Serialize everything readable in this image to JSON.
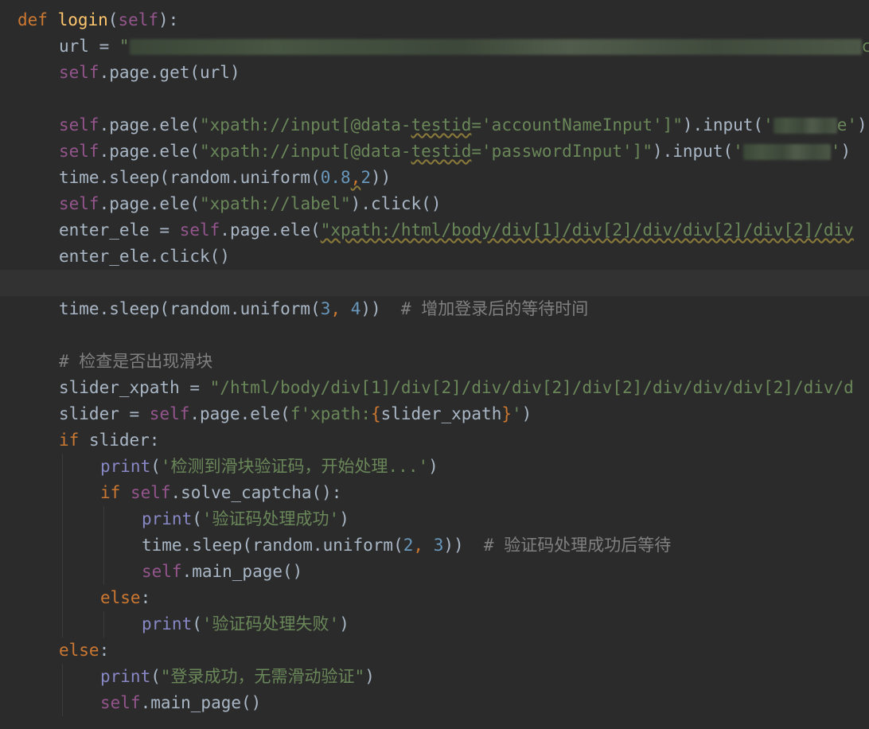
{
  "editor": {
    "theme_colors": {
      "background": "#2b2b2b",
      "current_line": "#323232",
      "keyword": "#cc7832",
      "self": "#94558d",
      "function_def": "#ffc66d",
      "string": "#6a8759",
      "number": "#6897bb",
      "builtin": "#8888c6",
      "comment": "#808080",
      "default": "#a9b7c6"
    },
    "current_line": 11,
    "lines": [
      {
        "indent": 0,
        "tokens": [
          {
            "t": "def ",
            "c": "kw"
          },
          {
            "t": "login",
            "c": "fn"
          },
          {
            "t": "("
          },
          {
            "t": "self",
            "c": "self"
          },
          {
            "t": "):"
          }
        ]
      },
      {
        "indent": 1,
        "tokens": [
          {
            "t": "url = "
          },
          {
            "t": "\"",
            "c": "str"
          },
          {
            "t": "",
            "redacted": true,
            "w": 920
          },
          {
            "t": "c",
            "c": "str"
          }
        ]
      },
      {
        "indent": 1,
        "tokens": [
          {
            "t": "self",
            "c": "self"
          },
          {
            "t": ".page.get(url)"
          }
        ]
      },
      {
        "indent": 1,
        "tokens": []
      },
      {
        "indent": 1,
        "tokens": [
          {
            "t": "self",
            "c": "self"
          },
          {
            "t": ".page.ele("
          },
          {
            "t": "\"xpath://input[@data-",
            "c": "str"
          },
          {
            "t": "testid",
            "c": "str",
            "warn": true
          },
          {
            "t": "='accountNameInput']\"",
            "c": "str"
          },
          {
            "t": ").input("
          },
          {
            "t": "'",
            "c": "str"
          },
          {
            "t": "",
            "redacted": true,
            "w": 80
          },
          {
            "t": "e'",
            "c": "str"
          },
          {
            "t": ")"
          }
        ]
      },
      {
        "indent": 1,
        "tokens": [
          {
            "t": "self",
            "c": "self"
          },
          {
            "t": ".page.ele("
          },
          {
            "t": "\"xpath://input[@data-",
            "c": "str"
          },
          {
            "t": "testid",
            "c": "str",
            "warn": true
          },
          {
            "t": "='passwordInput']\"",
            "c": "str"
          },
          {
            "t": ").input("
          },
          {
            "t": "'",
            "c": "str"
          },
          {
            "t": "",
            "redacted": true,
            "w": 110
          },
          {
            "t": "'",
            "c": "str"
          },
          {
            "t": ")"
          }
        ]
      },
      {
        "indent": 1,
        "tokens": [
          {
            "t": "time.sleep(random.uniform("
          },
          {
            "t": "0.8",
            "c": "num"
          },
          {
            "t": ",",
            "c": "kw",
            "warn": true
          },
          {
            "t": "2",
            "c": "num"
          },
          {
            "t": "))"
          }
        ]
      },
      {
        "indent": 1,
        "tokens": [
          {
            "t": "self",
            "c": "self"
          },
          {
            "t": ".page.ele("
          },
          {
            "t": "\"xpath://label\"",
            "c": "str"
          },
          {
            "t": ").click()"
          }
        ]
      },
      {
        "indent": 1,
        "tokens": [
          {
            "t": "enter_ele = "
          },
          {
            "t": "self",
            "c": "self"
          },
          {
            "t": ".page.ele("
          },
          {
            "t": "\"xpath:/html/body/div[1]/div[2]/div/div[2]/div[2]/div",
            "c": "str",
            "warn": true
          }
        ]
      },
      {
        "indent": 1,
        "tokens": [
          {
            "t": "enter_ele.click()"
          }
        ]
      },
      {
        "indent": 1,
        "tokens": []
      },
      {
        "indent": 1,
        "tokens": [
          {
            "t": "time.sleep(random.uniform("
          },
          {
            "t": "3",
            "c": "num"
          },
          {
            "t": ", ",
            "c": "kw"
          },
          {
            "t": "4",
            "c": "num"
          },
          {
            "t": "))  "
          },
          {
            "t": "# ",
            "c": "cmt"
          },
          {
            "t": "增加登录后的等待时间",
            "c": "cmt",
            "cn": true
          }
        ]
      },
      {
        "indent": 1,
        "tokens": []
      },
      {
        "indent": 1,
        "tokens": [
          {
            "t": "# ",
            "c": "cmt"
          },
          {
            "t": "检查是否出现滑块",
            "c": "cmt",
            "cn": true
          }
        ]
      },
      {
        "indent": 1,
        "tokens": [
          {
            "t": "slider_xpath = "
          },
          {
            "t": "\"/html/body/div[1]/div[2]/div/div[2]/div[2]/div/div/div[2]/div/d",
            "c": "str"
          }
        ]
      },
      {
        "indent": 1,
        "tokens": [
          {
            "t": "slider = "
          },
          {
            "t": "self",
            "c": "self"
          },
          {
            "t": ".page.ele("
          },
          {
            "t": "f'xpath:",
            "c": "str"
          },
          {
            "t": "{",
            "c": "kw"
          },
          {
            "t": "slider_xpath"
          },
          {
            "t": "}",
            "c": "kw"
          },
          {
            "t": "'",
            "c": "str"
          },
          {
            "t": ")"
          }
        ]
      },
      {
        "indent": 1,
        "tokens": [
          {
            "t": "if ",
            "c": "kw"
          },
          {
            "t": "slider:"
          }
        ]
      },
      {
        "indent": 2,
        "tokens": [
          {
            "t": "print",
            "c": "bi"
          },
          {
            "t": "("
          },
          {
            "t": "'",
            "c": "str"
          },
          {
            "t": "检测到滑块验证码，开始处理",
            "c": "str",
            "cn": true
          },
          {
            "t": "...'",
            "c": "str"
          },
          {
            "t": ")"
          }
        ]
      },
      {
        "indent": 2,
        "tokens": [
          {
            "t": "if ",
            "c": "kw"
          },
          {
            "t": "self",
            "c": "self"
          },
          {
            "t": ".solve_captcha():"
          }
        ]
      },
      {
        "indent": 3,
        "tokens": [
          {
            "t": "print",
            "c": "bi"
          },
          {
            "t": "("
          },
          {
            "t": "'",
            "c": "str"
          },
          {
            "t": "验证码处理成功",
            "c": "str",
            "cn": true
          },
          {
            "t": "'",
            "c": "str"
          },
          {
            "t": ")"
          }
        ]
      },
      {
        "indent": 3,
        "tokens": [
          {
            "t": "time.sleep(random.uniform("
          },
          {
            "t": "2",
            "c": "num"
          },
          {
            "t": ", ",
            "c": "kw"
          },
          {
            "t": "3",
            "c": "num"
          },
          {
            "t": "))  "
          },
          {
            "t": "# ",
            "c": "cmt"
          },
          {
            "t": "验证码处理成功后等待",
            "c": "cmt",
            "cn": true
          }
        ]
      },
      {
        "indent": 3,
        "tokens": [
          {
            "t": "self",
            "c": "self"
          },
          {
            "t": ".main_page()"
          }
        ]
      },
      {
        "indent": 2,
        "tokens": [
          {
            "t": "else",
            "c": "kw"
          },
          {
            "t": ":"
          }
        ]
      },
      {
        "indent": 3,
        "tokens": [
          {
            "t": "print",
            "c": "bi"
          },
          {
            "t": "("
          },
          {
            "t": "'",
            "c": "str"
          },
          {
            "t": "验证码处理失败",
            "c": "str",
            "cn": true
          },
          {
            "t": "'",
            "c": "str"
          },
          {
            "t": ")"
          }
        ]
      },
      {
        "indent": 1,
        "tokens": [
          {
            "t": "else",
            "c": "kw"
          },
          {
            "t": ":"
          }
        ]
      },
      {
        "indent": 2,
        "tokens": [
          {
            "t": "print",
            "c": "bi"
          },
          {
            "t": "("
          },
          {
            "t": "\"",
            "c": "str"
          },
          {
            "t": "登录成功，无需滑动验证",
            "c": "str",
            "cn": true
          },
          {
            "t": "\"",
            "c": "str"
          },
          {
            "t": ")"
          }
        ]
      },
      {
        "indent": 2,
        "tokens": [
          {
            "t": "self",
            "c": "self"
          },
          {
            "t": ".main_page()"
          }
        ]
      }
    ]
  }
}
